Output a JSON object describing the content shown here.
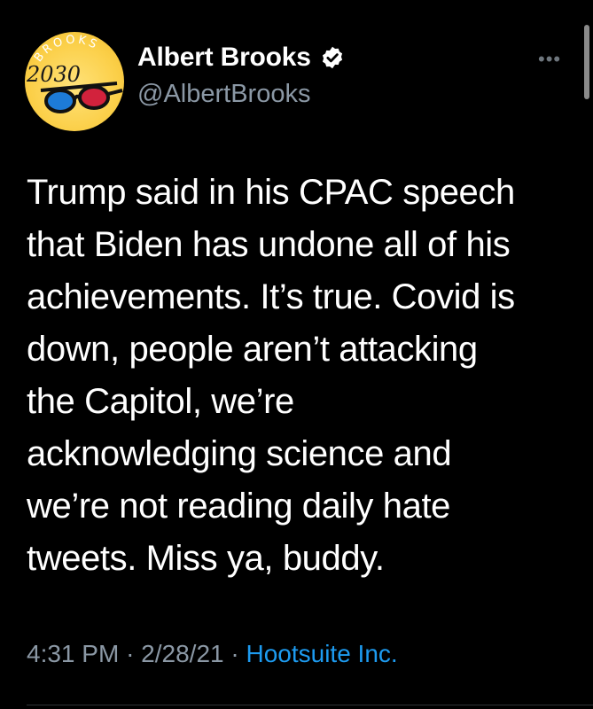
{
  "author": {
    "display_name": "Albert Brooks",
    "handle": "@AlbertBrooks",
    "verified": true,
    "avatar_text_top": "BROOKS",
    "avatar_text_year": "2030"
  },
  "more_label": "•••",
  "tweet": {
    "lines": [
      "Trump said in his CPAC speech",
      "that Biden has undone all of his",
      "achievements. It’s true. Covid is",
      "down, people aren’t attacking",
      "the Capitol, we’re",
      "acknowledging science and",
      "we’re not reading daily hate",
      "tweets. Miss ya, buddy."
    ]
  },
  "meta": {
    "time": "4:31 PM",
    "separator": "·",
    "date": "2/28/21",
    "source": "Hootsuite Inc."
  },
  "colors": {
    "background": "#000000",
    "text": "#ffffff",
    "secondary": "#8b98a5",
    "link": "#1d9bf0",
    "verified": "#ffffff"
  }
}
